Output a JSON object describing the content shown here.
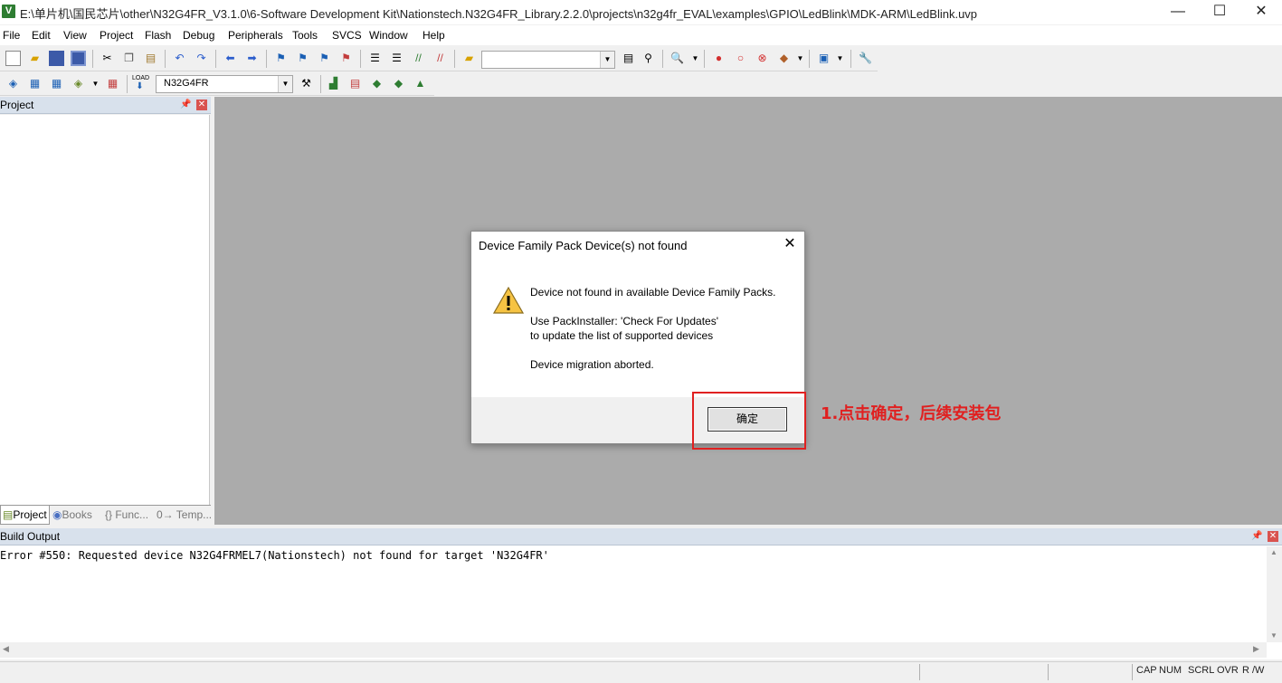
{
  "window": {
    "title": "E:\\单片机\\国民芯片\\other\\N32G4FR_V3.1.0\\6-Software Development Kit\\Nationstech.N32G4FR_Library.2.2.0\\projects\\n32g4fr_EVAL\\examples\\GPIO\\LedBlink\\MDK-ARM\\LedBlink.uvp",
    "app_icon_letter": "V",
    "minimize": "—",
    "maximize": "☐",
    "close": "✕"
  },
  "menu": {
    "items": [
      "File",
      "Edit",
      "View",
      "Project",
      "Flash",
      "Debug",
      "Peripherals",
      "Tools",
      "SVCS",
      "Window",
      "Help"
    ]
  },
  "toolbar2": {
    "target_select": "N32G4FR",
    "load_label": "LOAD"
  },
  "project_panel": {
    "title": "Project",
    "tabs": [
      "Project",
      "Books",
      "{} Func...",
      "0→ Temp..."
    ]
  },
  "dialog": {
    "title": "Device Family Pack Device(s) not found",
    "line1": "Device not found in available Device Family Packs.",
    "line2": "Use PackInstaller: 'Check For Updates'",
    "line3": "to update the list of supported devices",
    "line4": "Device migration aborted.",
    "ok_label": "确定"
  },
  "annotation": {
    "text": "1.点击确定，后续安装包",
    "color": "#e02020"
  },
  "build_output": {
    "title": "Build Output",
    "lines": [
      "Error #550: Requested device N32G4FRMEL7(Nationstech) not found for target 'N32G4FR'"
    ]
  },
  "statusbar": {
    "cap": "CAP",
    "num": "NUM",
    "scrl": "SCRL",
    "ovr": "OVR",
    "rw": "R /W"
  }
}
